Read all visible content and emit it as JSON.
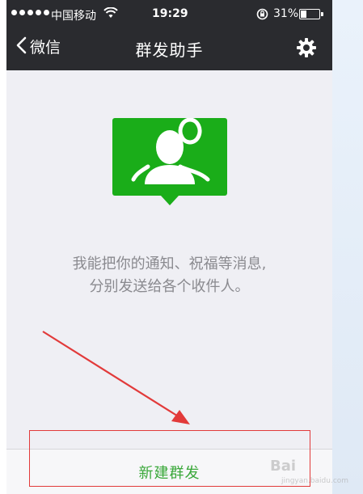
{
  "status_bar": {
    "carrier": "中国移动",
    "time": "19:29",
    "battery": "31%",
    "battery_level": 0.31
  },
  "nav": {
    "back_label": "微信",
    "title": "群发助手",
    "settings_icon": "gear-icon"
  },
  "main": {
    "logo_icon": "group-people-icon",
    "description_lines": [
      "我能把你的通知、祝福等消息,",
      "分别发送给各个收件人。"
    ]
  },
  "bottom": {
    "new_group_label": "新建群发"
  },
  "watermark": {
    "text": "Bai",
    "sub": "jingyan.baidu.com"
  },
  "colors": {
    "nav_background": "#2a2b2f",
    "page_background": "#efeff4",
    "accent_green": "#1aad19",
    "button_text": "#3aa83a",
    "annotation_red": "#e23a3a"
  }
}
